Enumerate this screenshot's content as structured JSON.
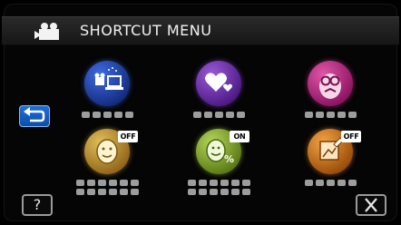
{
  "header": {
    "title": "SHORTCUT MENU",
    "mode_icon": "video-camera-icon"
  },
  "nav": {
    "back_icon": "return-arrow-icon",
    "help_label": "?",
    "close_icon": "close-x-icon"
  },
  "items": [
    {
      "icon": "camera-to-laptop-icon",
      "color": "#1c3f9e",
      "label": "",
      "badge": ""
    },
    {
      "icon": "hearts-icon",
      "color": "#6a2aa4",
      "label": "",
      "badge": ""
    },
    {
      "icon": "face-mask-icon",
      "color": "#b0237a",
      "label": "",
      "badge": ""
    },
    {
      "icon": "smile-face-icon",
      "color": "#c89a2a",
      "label": "",
      "badge": "OFF"
    },
    {
      "icon": "smile-percent-icon",
      "color": "#86a92e",
      "label": "",
      "badge": "ON"
    },
    {
      "icon": "picture-edit-icon",
      "color": "#dd7e1c",
      "label": "",
      "badge": "OFF"
    }
  ],
  "colors": {
    "background": "#000000",
    "header": "#222222",
    "back_button": "#1565c8",
    "label_blur": "#c8c8c8"
  }
}
